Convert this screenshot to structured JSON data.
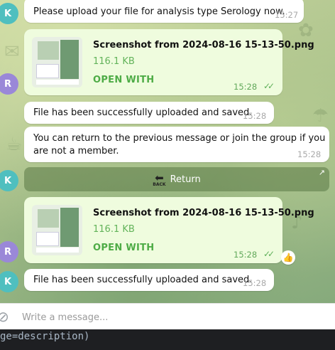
{
  "messages": {
    "m1": {
      "avatar": "K",
      "text": "Please upload your file for analysis type Serology now.",
      "time": "15:27"
    },
    "file1": {
      "avatar": "R",
      "name": "Screenshot from 2024-08-16 15-13-50.png",
      "size": "116.1 KB",
      "open_label": "OPEN WITH",
      "time": "15:28"
    },
    "m2": {
      "text": "File has been successfully uploaded and saved.",
      "time": "15:28"
    },
    "m3": {
      "text_line1": "You can return to the previous message or join the group if you",
      "text_line2": "are not a member.",
      "time": "15:28"
    },
    "return_button": {
      "avatar": "K",
      "label": "Return",
      "icon_word": "BACK",
      "icon": "back-arrow-icon"
    },
    "file2": {
      "avatar": "R",
      "name": "Screenshot from 2024-08-16 15-13-50.png",
      "size": "116.1 KB",
      "open_label": "OPEN WITH",
      "time": "15:28",
      "reaction": "👍"
    },
    "m4": {
      "avatar": "K",
      "text": "File has been successfully uploaded and saved.",
      "time": "15:28"
    }
  },
  "composer": {
    "placeholder": "Write a message..."
  },
  "code_panel": {
    "line1": "ge=description)",
    "line2": ""
  },
  "colors": {
    "incoming_bubble": "#ffffff",
    "outgoing_bubble": "#effcde",
    "read_check": "#5fb05a",
    "avatar_k": "#4fbfbf",
    "avatar_r": "#9a88d8"
  }
}
